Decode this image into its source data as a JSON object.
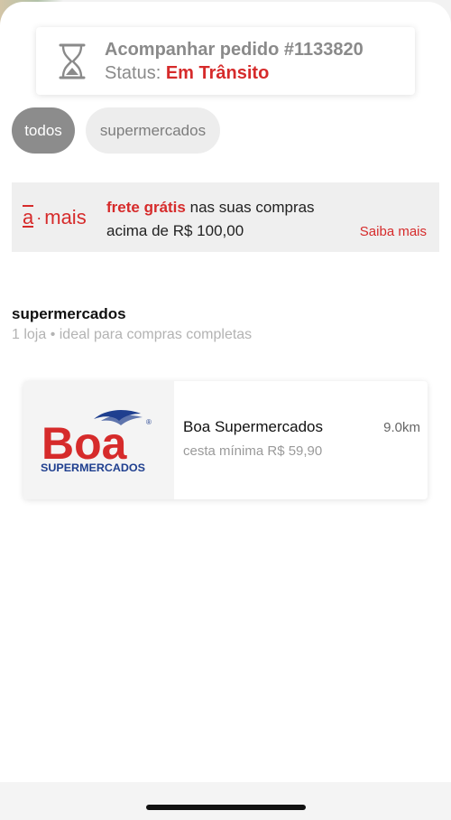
{
  "order": {
    "title": "Acompanhar pedido #1133820",
    "status_label": "Status:",
    "status_value": "Em Trânsito",
    "icon": "hourglass-icon"
  },
  "filters": [
    {
      "label": "todos",
      "selected": true
    },
    {
      "label": "supermercados",
      "selected": false
    }
  ],
  "promo": {
    "logo_a": "a",
    "logo_dot": "·",
    "logo_word": "mais",
    "highlight": "frete grátis",
    "text_rest": "nas suas compras acima de R$ 100,00",
    "link": "Saiba mais"
  },
  "section": {
    "title": "supermercados",
    "subtitle": "1 loja • ideal para compras completas"
  },
  "stores": [
    {
      "name": "Boa Supermercados",
      "distance": "9.0km",
      "min_basket": "cesta mínima R$ 59,90",
      "logo_text": "Boa",
      "logo_subtext": "SUPERMERCADOS",
      "logo_mark": "®"
    }
  ],
  "colors": {
    "accent": "#d62b2b",
    "chip_selected": "#8c8c8c",
    "chip_unselected": "#ededed",
    "brand_blue": "#1f3f8f"
  }
}
